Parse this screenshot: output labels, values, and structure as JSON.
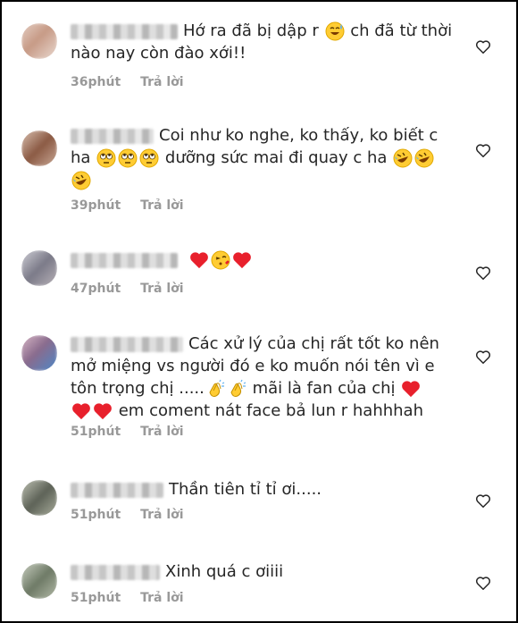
{
  "comments": [
    {
      "text": "Hớ ra đã bị dập r",
      "text_after": "ch đã từ thời nào nay còn đào xới!!",
      "time": "36phút",
      "reply": "Trả lời",
      "emojis": [
        "sweat-smile-emoji"
      ]
    },
    {
      "text_line1": "Coi như ko nghe, ko thấy, ko biết c",
      "text_line2a": "ha",
      "text_line2b": "dưỡng sức mai đi quay c ha",
      "time": "39phút",
      "reply": "Trả lời",
      "emojis": [
        "rolling-eyes-emoji",
        "rolling-eyes-emoji",
        "rolling-eyes-emoji",
        "rofl-emoji",
        "rofl-emoji",
        "rofl-emoji"
      ]
    },
    {
      "time": "47phút",
      "reply": "Trả lời",
      "emojis": [
        "red-heart-emoji",
        "kiss-emoji",
        "red-heart-emoji"
      ]
    },
    {
      "text_line1": "Các xử lý của chị rất tốt ko nên",
      "text_line2": "mở miệng vs người đó e ko muốn nói tên vì e",
      "text_line3a": "tôn trọng chị .....",
      "text_line3b": "mãi là fan của chị",
      "text_line4": "em coment nát face bả lun r hahhhah",
      "time": "51phút",
      "reply": "Trả lời",
      "emojis": [
        "clap-emoji",
        "clap-emoji",
        "red-heart-emoji",
        "red-heart-emoji",
        "red-heart-emoji"
      ]
    },
    {
      "text": "Thần tiên tỉ tỉ ơi.....",
      "time": "51phút",
      "reply": "Trả lời"
    },
    {
      "text": "Xinh quá c ơiiii",
      "time": "51phút",
      "reply": "Trả lời"
    }
  ],
  "colors": {
    "text": "#262626",
    "meta": "#999999",
    "heart": "#e0245e"
  }
}
